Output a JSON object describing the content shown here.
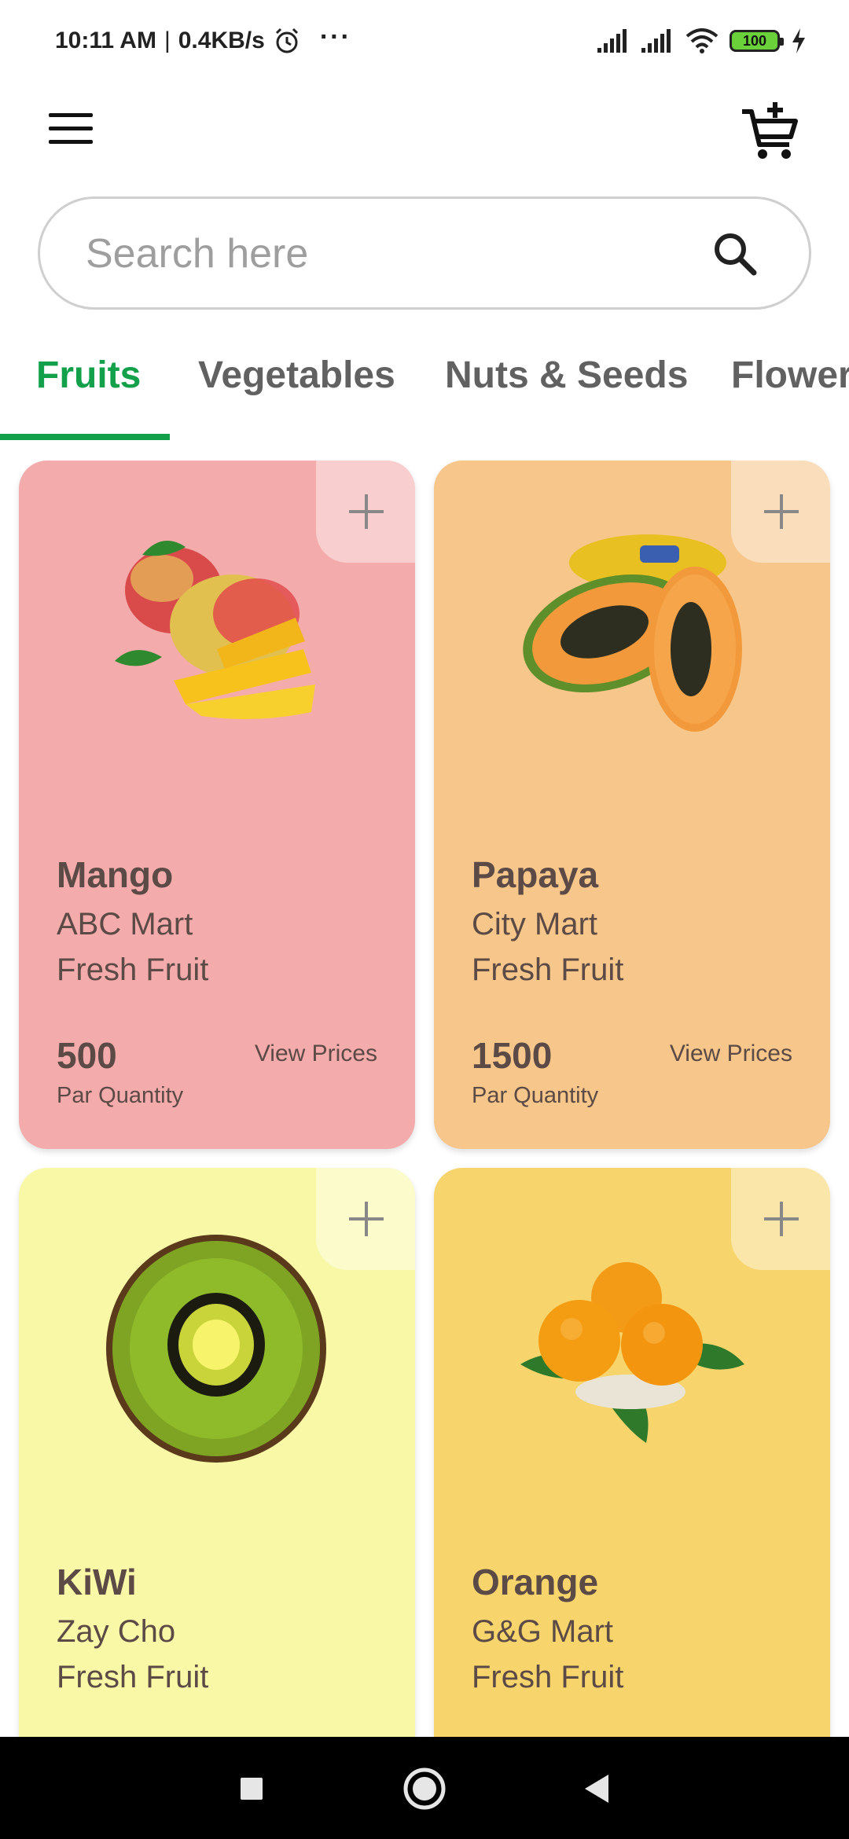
{
  "status_bar": {
    "time": "10:11 AM",
    "separator": "|",
    "speed": "0.4KB/s",
    "more": "···",
    "battery": "100"
  },
  "search": {
    "placeholder": "Search here"
  },
  "tabs": [
    {
      "label": "Fruits",
      "active": true
    },
    {
      "label": "Vegetables",
      "active": false
    },
    {
      "label": "Nuts & Seeds",
      "active": false
    },
    {
      "label": "Flowers",
      "active": false
    }
  ],
  "products": [
    {
      "name": "Mango",
      "store": "ABC Mart",
      "category": "Fresh Fruit",
      "quantity": "500",
      "quantity_label": "Par Quantity",
      "view_prices": "View Prices",
      "bg_color": "#f4abab",
      "image": "mango-image"
    },
    {
      "name": "Papaya",
      "store": "City Mart",
      "category": "Fresh Fruit",
      "quantity": "1500",
      "quantity_label": "Par Quantity",
      "view_prices": "View Prices",
      "bg_color": "#f7c68a",
      "image": "papaya-image"
    },
    {
      "name": "KiWi",
      "store": "Zay Cho",
      "category": "Fresh Fruit",
      "quantity": "",
      "quantity_label": "",
      "view_prices": "",
      "bg_color": "#f8f8a6",
      "image": "kiwi-image"
    },
    {
      "name": "Orange",
      "store": "G&G Mart",
      "category": "Fresh Fruit",
      "quantity": "",
      "quantity_label": "",
      "view_prices": "",
      "bg_color": "#f7d46c",
      "image": "orange-image"
    }
  ],
  "colors": {
    "accent": "#12a04a",
    "text": "#5b4a45"
  },
  "icons": {
    "menu": "hamburger-menu-icon",
    "cart": "add-to-cart-icon",
    "search": "search-icon",
    "add": "plus-icon",
    "nav_recent": "square-icon",
    "nav_home": "circle-icon",
    "nav_back": "triangle-back-icon"
  }
}
